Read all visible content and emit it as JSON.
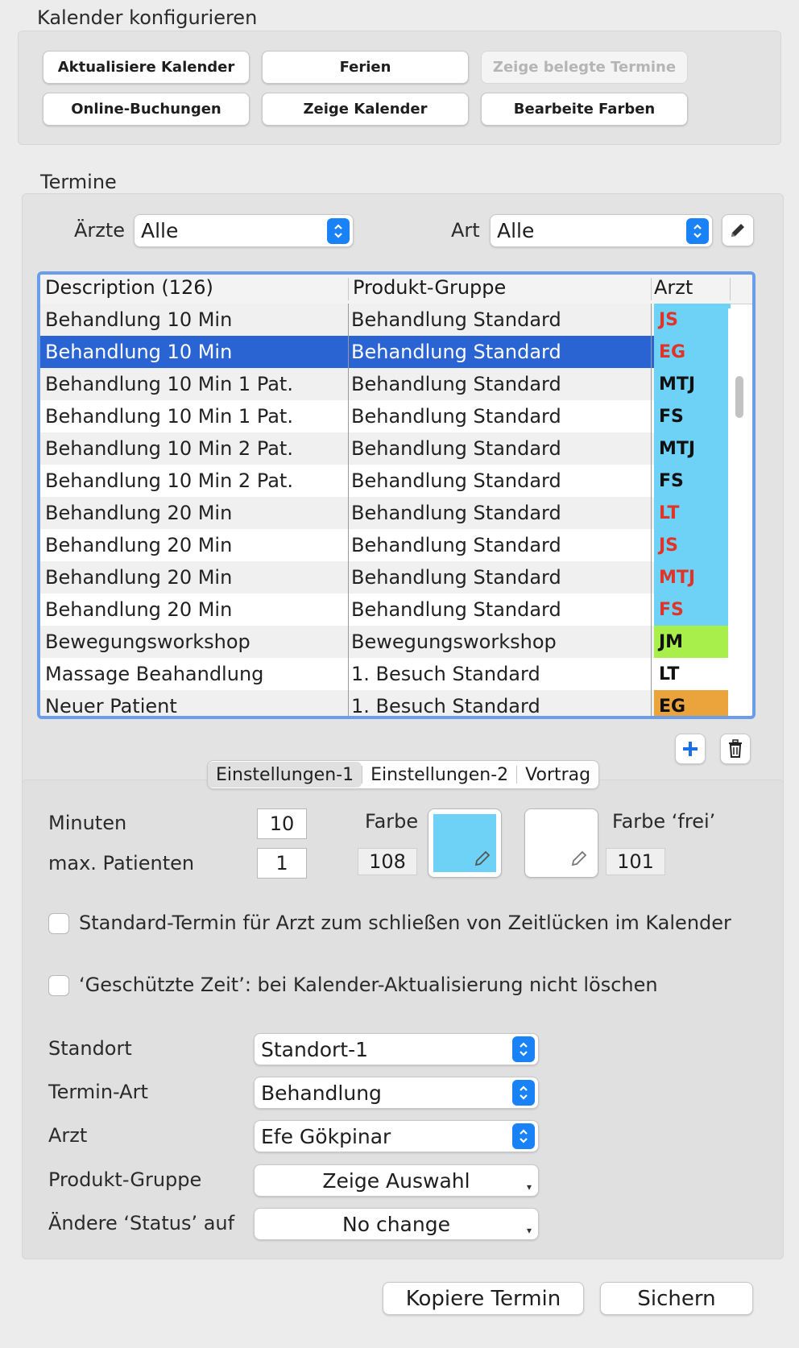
{
  "config": {
    "title": "Kalender konfigurieren",
    "buttons": {
      "refresh": "Aktualisiere Kalender",
      "holidays": "Ferien",
      "show_booked": "Zeige belegte Termine",
      "online": "Online-Buchungen",
      "show_calendar": "Zeige Kalender",
      "edit_colors": "Bearbeite Farben"
    }
  },
  "appointments": {
    "title": "Termine",
    "doctors_label": "Ärzte",
    "doctors_value": "Alle",
    "type_label": "Art",
    "type_value": "Alle",
    "table": {
      "headers": [
        "Description (126)",
        "Produkt-Gruppe",
        "Arzt"
      ],
      "rows": [
        {
          "desc": "Behandlung 10 Min",
          "group": "Behandlung Standard",
          "doctor": "JS",
          "fg": "#e0342a",
          "bg": "#6dd2f5"
        },
        {
          "desc": "Behandlung 10 Min",
          "group": "Behandlung Standard",
          "doctor": "EG",
          "fg": "#e0342a",
          "bg": "#6dd2f5"
        },
        {
          "desc": "Behandlung 10 Min 1 Pat.",
          "group": "Behandlung Standard",
          "doctor": "MTJ",
          "fg": "#111111",
          "bg": "#6dd2f5"
        },
        {
          "desc": "Behandlung 10 Min 1 Pat.",
          "group": "Behandlung Standard",
          "doctor": "FS",
          "fg": "#111111",
          "bg": "#6dd2f5"
        },
        {
          "desc": "Behandlung 10 Min 2 Pat.",
          "group": "Behandlung Standard",
          "doctor": "MTJ",
          "fg": "#111111",
          "bg": "#6dd2f5"
        },
        {
          "desc": "Behandlung 10 Min 2 Pat.",
          "group": "Behandlung Standard",
          "doctor": "FS",
          "fg": "#111111",
          "bg": "#6dd2f5"
        },
        {
          "desc": "Behandlung 20 Min",
          "group": "Behandlung Standard",
          "doctor": "LT",
          "fg": "#e0342a",
          "bg": "#6dd2f5"
        },
        {
          "desc": "Behandlung 20 Min",
          "group": "Behandlung Standard",
          "doctor": "JS",
          "fg": "#e0342a",
          "bg": "#6dd2f5"
        },
        {
          "desc": "Behandlung 20 Min",
          "group": "Behandlung Standard",
          "doctor": "MTJ",
          "fg": "#e0342a",
          "bg": "#6dd2f5"
        },
        {
          "desc": "Behandlung 20 Min",
          "group": "Behandlung Standard",
          "doctor": "FS",
          "fg": "#e0342a",
          "bg": "#6dd2f5"
        },
        {
          "desc": "Bewegungsworkshop",
          "group": "Bewegungsworkshop",
          "doctor": "JM",
          "fg": "#111111",
          "bg": "#a8ef4c"
        },
        {
          "desc": "Massage Beahandlung",
          "group": "1. Besuch Standard",
          "doctor": "LT",
          "fg": "#111111",
          "bg": "#ffffff"
        },
        {
          "desc": "Neuer Patient",
          "group": "1. Besuch Standard",
          "doctor": "EG",
          "fg": "#111111",
          "bg": "#eba43c"
        }
      ],
      "selected_index": 1,
      "selection_color": "#2a64d2"
    },
    "tabs": [
      "Einstellungen-1",
      "Einstellungen-2",
      "Vortrag"
    ],
    "active_tab": 0,
    "settings": {
      "minutes_label": "Minuten",
      "minutes_value": "10",
      "max_patients_label": "max. Patienten",
      "max_patients_value": "1",
      "color_label": "Farbe",
      "color_value": "108",
      "color_hex": "#6dd2f5",
      "free_color_label": "Farbe ‘frei’",
      "free_color_value": "101",
      "free_color_hex": "#ffffff",
      "checkbox_standard": "Standard-Termin für Arzt zum schließen von Zeitlücken im Kalender",
      "checkbox_protected": "‘Geschützte Zeit’: bei Kalender-Aktualisierung nicht löschen",
      "location_label": "Standort",
      "location_value": "Standort-1",
      "appt_type_label": "Termin-Art",
      "appt_type_value": "Behandlung",
      "doctor_label": "Arzt",
      "doctor_value": "Efe Gökpinar",
      "product_group_label": "Produkt-Gruppe",
      "product_group_value": "Zeige Auswahl",
      "status_label": "Ändere ‘Status’ auf",
      "status_value": "No change"
    }
  },
  "footer": {
    "copy": "Kopiere Termin",
    "save": "Sichern"
  }
}
